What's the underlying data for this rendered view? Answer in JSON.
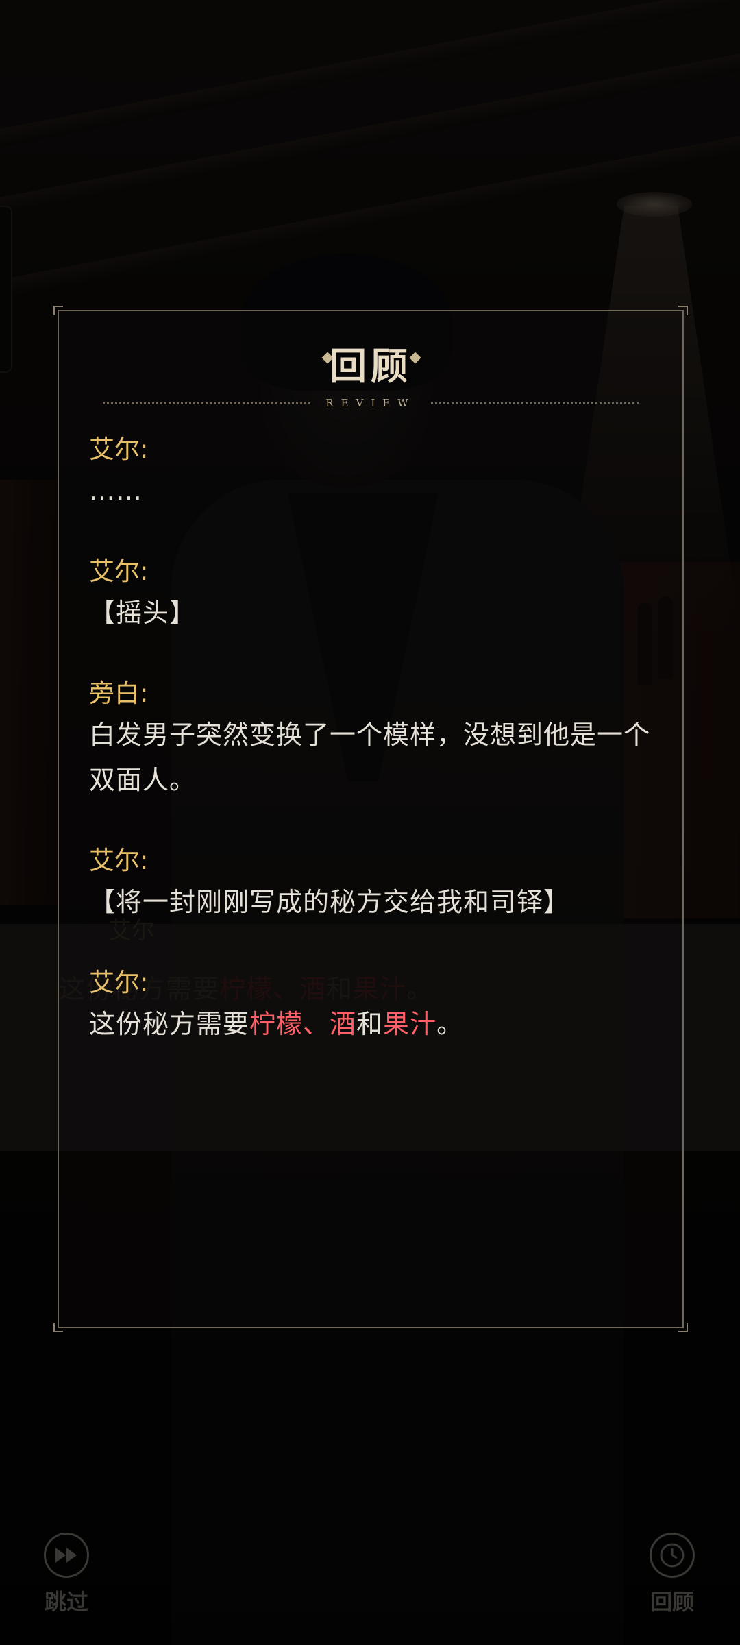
{
  "review_panel": {
    "title": "回顾",
    "subtitle": "REVIEW",
    "entries": [
      {
        "speaker": "艾尔:",
        "segments": [
          {
            "text": "……"
          }
        ]
      },
      {
        "speaker": "艾尔:",
        "segments": [
          {
            "text": "【摇头】"
          }
        ]
      },
      {
        "speaker": "旁白:",
        "segments": [
          {
            "text": "白发男子突然变换了一个模样，没想到他是一个双面人。"
          }
        ]
      },
      {
        "speaker": "艾尔:",
        "segments": [
          {
            "text": "【将一封刚刚写成的秘方交给我和司铎】"
          }
        ]
      },
      {
        "speaker": "艾尔:",
        "segments": [
          {
            "text": "这份秘方需要"
          },
          {
            "text": "柠檬、酒",
            "highlight": true
          },
          {
            "text": "和"
          },
          {
            "text": "果汁",
            "highlight": true
          },
          {
            "text": "。"
          }
        ]
      }
    ]
  },
  "background_dialogue": {
    "speaker": "艾尔",
    "segments": [
      {
        "text": "这份秘方需要"
      },
      {
        "text": "柠檬、酒",
        "highlight": true
      },
      {
        "text": "和"
      },
      {
        "text": "果汁",
        "highlight": true
      },
      {
        "text": "。"
      }
    ]
  },
  "controls": {
    "skip": {
      "label": "跳过",
      "icon": "fast-forward-icon"
    },
    "review": {
      "label": "回顾",
      "icon": "clock-icon"
    }
  },
  "colors": {
    "speaker": "#e7c067",
    "text": "#e6e1d8",
    "highlight": "#ff5f66",
    "panel_border": "#6e6658"
  }
}
